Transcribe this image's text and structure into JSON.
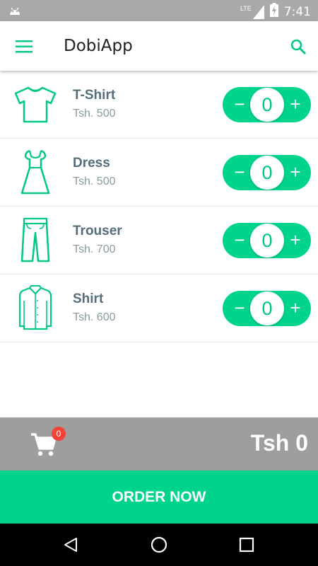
{
  "status_bar": {
    "network": "LTE",
    "time": "7:41"
  },
  "app_bar": {
    "title": "DobiApp"
  },
  "items": [
    {
      "name": "T-Shirt",
      "price": "Tsh. 500",
      "quantity": "0",
      "icon": "tshirt-icon"
    },
    {
      "name": "Dress",
      "price": "Tsh. 500",
      "quantity": "0",
      "icon": "dress-icon"
    },
    {
      "name": "Trouser",
      "price": "Tsh. 700",
      "quantity": "0",
      "icon": "trouser-icon"
    },
    {
      "name": "Shirt",
      "price": "Tsh. 600",
      "quantity": "0",
      "icon": "shirt-icon"
    }
  ],
  "stepper": {
    "minus": "−",
    "plus": "+"
  },
  "cart": {
    "badge_count": "0",
    "total": "Tsh 0"
  },
  "order_button": {
    "label": "ORDER NOW"
  },
  "colors": {
    "accent": "#00d38d",
    "cart_bar": "#9e9e9e",
    "badge": "#f44336",
    "text_primary": "#546e7a"
  }
}
